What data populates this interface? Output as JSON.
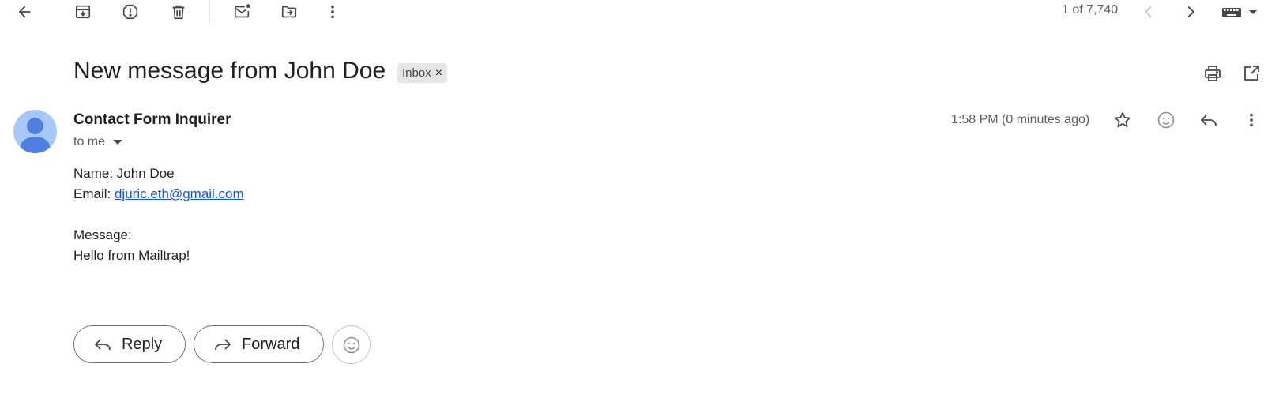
{
  "toolbar": {
    "counter": "1 of 7,740",
    "icons": [
      "back-arrow-icon",
      "archive-icon",
      "report-spam-icon",
      "delete-icon",
      "mark-unread-icon",
      "move-to-icon",
      "more-vert-icon",
      "newer-chevron-icon",
      "older-chevron-icon",
      "keyboard-icon"
    ]
  },
  "email": {
    "subject": "New message from John Doe",
    "label": "Inbox",
    "label_close": "×",
    "sender": "Contact Form Inquirer",
    "recipient": "to me",
    "timestamp": "1:58 PM (0 minutes ago)",
    "body": {
      "name_line": "Name: John Doe",
      "email_prefix": "Email: ",
      "email_link": "djuric.eth@gmail.com",
      "message_label": "Message:",
      "message_text": "Hello from Mailtrap!"
    }
  },
  "actions": {
    "reply_label": "Reply",
    "forward_label": "Forward"
  },
  "colors": {
    "avatar_bg": "#a8c7fa",
    "avatar_fg": "#4f7fe0",
    "link": "#1a55d6",
    "chip_bg": "#e6e6e6"
  }
}
